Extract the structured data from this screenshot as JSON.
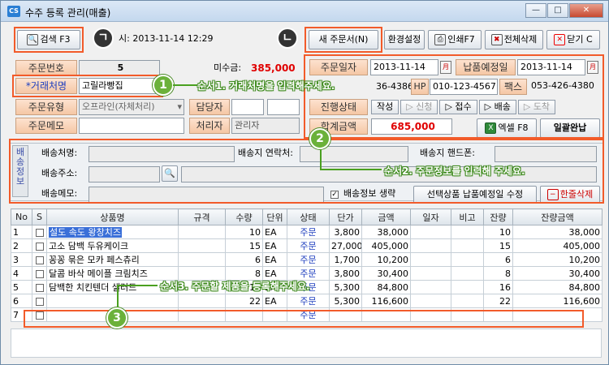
{
  "window": {
    "title": "수주 등록 관리(매출)",
    "icon": "CS",
    "minimize": "—",
    "maximize": "□",
    "close": "✕"
  },
  "toolbar": {
    "search_label": "검색 F3",
    "new_order_label": "새 주문서(N)",
    "settings_label": "환경설정",
    "print_label": "인쇄F7",
    "delete_all_label": "전체삭제",
    "close_label": "닫기 C",
    "datetime_partial": "시: 2013-11-14 12:29",
    "marker_left": "ㄱ",
    "marker_right": "ㄴ"
  },
  "form": {
    "order_no_label": "주문번호",
    "order_no_value": "5",
    "unpaid_label": "미수금:",
    "unpaid_value": "385,000",
    "client_label": "*거래처명",
    "client_value": "고릴라빵집",
    "phone_partial": "36-4386",
    "hp_label": "HP",
    "hp_value": "010-123-4567",
    "fax_label": "팩스",
    "fax_value": "053-426-4380",
    "order_type_label": "주문유형",
    "order_type_value": "오프라인(자체처리)",
    "manager_label": "담당자",
    "memo_label": "주문메모",
    "handler_label": "처리자",
    "handler_value": "관리자",
    "order_date_label": "주문일자",
    "order_date_value": "2013-11-14",
    "delivery_date_label": "납품예정일",
    "delivery_date_value": "2013-11-14",
    "status_label": "진행상태",
    "status_steps": [
      "작성",
      "▷ 신청",
      "▷ 접수",
      "▷ 배송",
      "▷ 도착"
    ],
    "total_label": "합계금액",
    "total_value": "685,000",
    "excel_label": "엑셀 F8",
    "bulk_done_label": "일괄완납",
    "cal_icon": "月"
  },
  "shipping": {
    "side_label": "배송정보",
    "name_label": "배송처명:",
    "contact_label": "배송지 연락처:",
    "mobile_label": "배송지 핸드폰:",
    "address_label": "배송주소:",
    "memo_label": "배송메모:",
    "omit_label": "배송정보 생략",
    "update_delivery_label": "선택상품 납품예정일 수정",
    "delete_row_label": "한줄삭제"
  },
  "grid": {
    "columns": [
      "No",
      "S",
      "상품명",
      "규격",
      "수량",
      "단위",
      "상태",
      "단가",
      "금액",
      "일자",
      "비고",
      "잔량",
      "잔량금액"
    ],
    "rows": [
      {
        "no": "1",
        "name": "설도 속도 왕창치즈",
        "spec": "",
        "qty": "10",
        "unit": "EA",
        "status": "주문",
        "price": "3,800",
        "amount": "38,000",
        "date": "",
        "note": "",
        "remain": "10",
        "remain_amount": "38,000"
      },
      {
        "no": "2",
        "name": "고소 담백 두유케이크",
        "spec": "",
        "qty": "15",
        "unit": "EA",
        "status": "주문",
        "price": "27,000",
        "amount": "405,000",
        "date": "",
        "note": "",
        "remain": "15",
        "remain_amount": "405,000"
      },
      {
        "no": "3",
        "name": "꽁꽁 묶은 모카 페스츄리",
        "spec": "",
        "qty": "6",
        "unit": "EA",
        "status": "주문",
        "price": "1,700",
        "amount": "10,200",
        "date": "",
        "note": "",
        "remain": "6",
        "remain_amount": "10,200"
      },
      {
        "no": "4",
        "name": "달콤 바삭 메이플 크림치즈",
        "spec": "",
        "qty": "8",
        "unit": "EA",
        "status": "주문",
        "price": "3,800",
        "amount": "30,400",
        "date": "",
        "note": "",
        "remain": "8",
        "remain_amount": "30,400"
      },
      {
        "no": "5",
        "name": "담백한 치킨텐더 샐러드",
        "spec": "",
        "qty": "16",
        "unit": "EA",
        "status": "주문",
        "price": "5,300",
        "amount": "84,800",
        "date": "",
        "note": "",
        "remain": "16",
        "remain_amount": "84,800"
      },
      {
        "no": "6",
        "name": "",
        "spec": "",
        "qty": "22",
        "unit": "EA",
        "status": "주문",
        "price": "5,300",
        "amount": "116,600",
        "date": "",
        "note": "",
        "remain": "22",
        "remain_amount": "116,600"
      },
      {
        "no": "7",
        "name": "",
        "spec": "",
        "qty": "",
        "unit": "",
        "status": "주문",
        "price": "",
        "amount": "",
        "date": "",
        "note": "",
        "remain": "",
        "remain_amount": ""
      }
    ]
  },
  "callouts": {
    "step1_num": "1",
    "step1_text": "순서1. 거래처명을 입력해주세요.",
    "step2_num": "2",
    "step2_text": "순서2. 주문정보를 입력해 주세요.",
    "step3_num": "3",
    "step3_text": "순서3. 주문할 제품을 등록해주세요."
  },
  "colors": {
    "highlight": "#f25b2a",
    "callout": "#6bb13a",
    "label_bg": "#f5c7a5",
    "amount_red": "#e00000"
  }
}
